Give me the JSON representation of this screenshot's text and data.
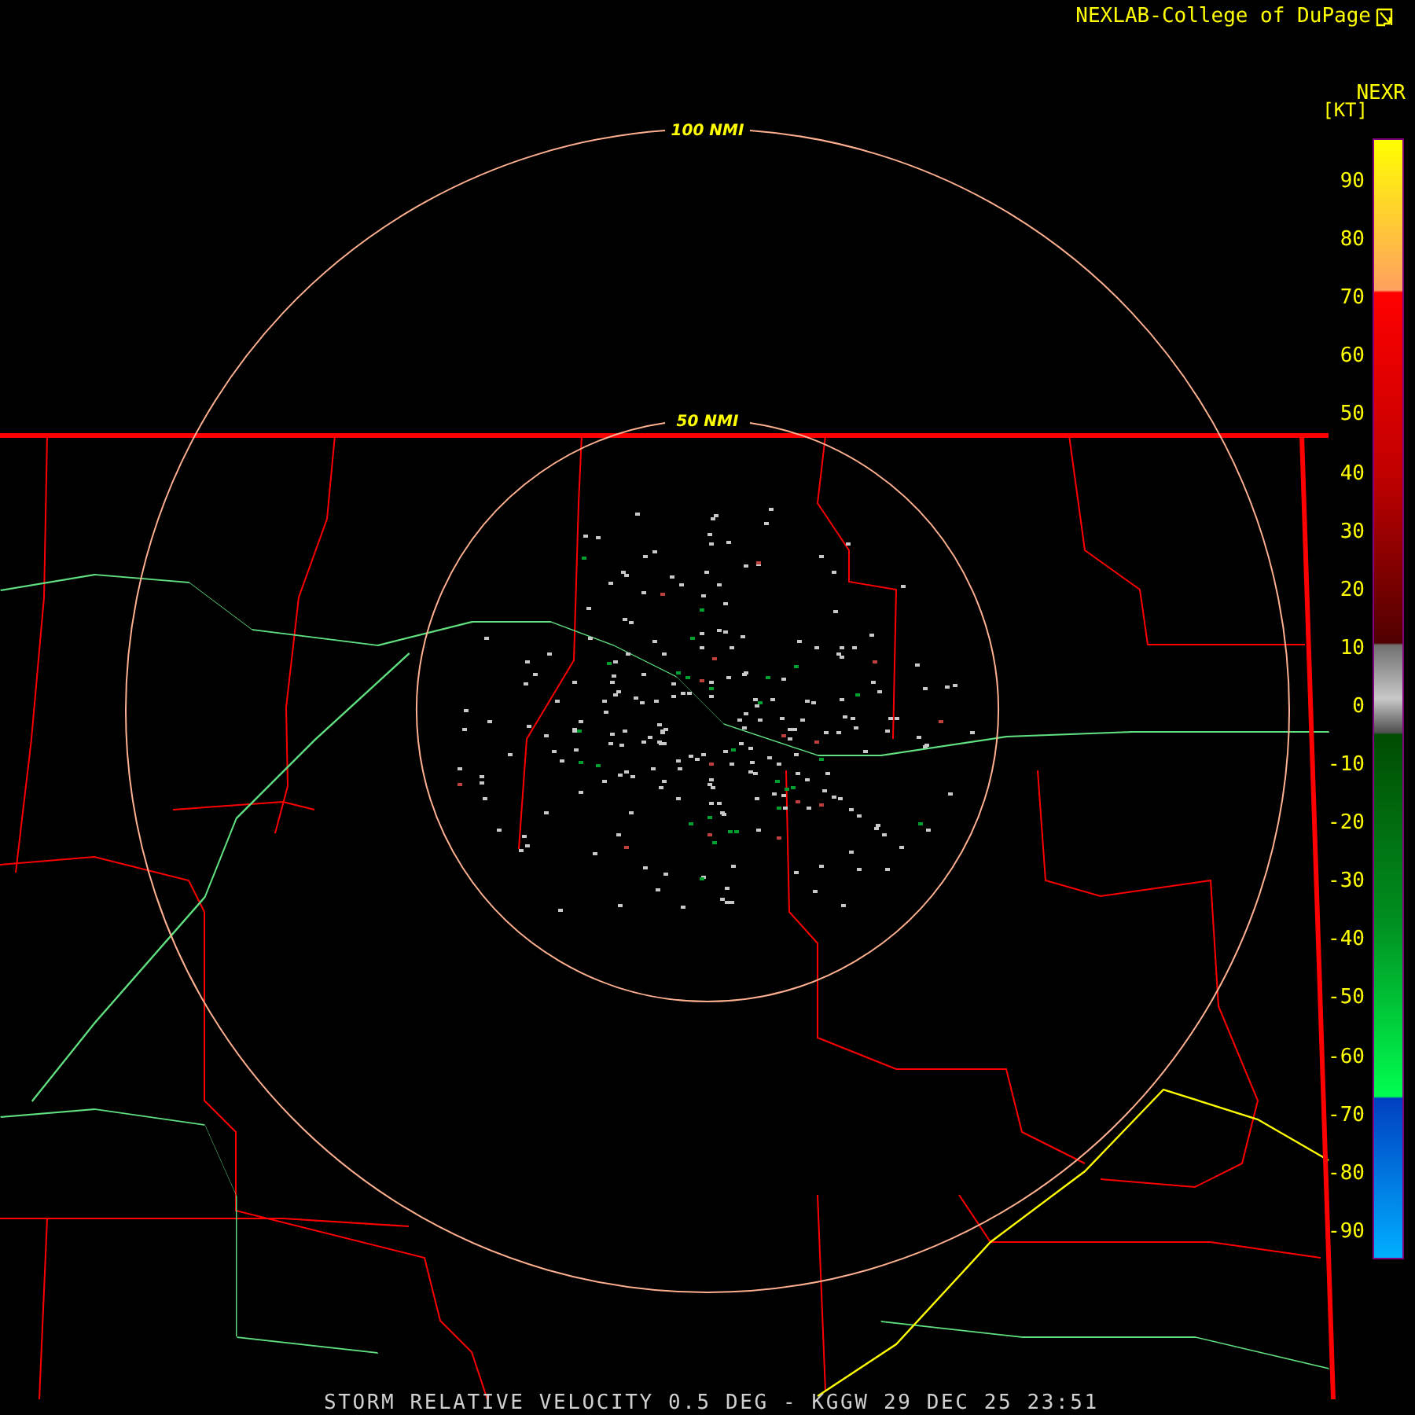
{
  "header": {
    "credit": "NEXLAB-College of DuPage",
    "product": "NEXR",
    "unit": "[KT]"
  },
  "range_rings": [
    {
      "label": "100 NMI"
    },
    {
      "label": "50 NMI"
    }
  ],
  "legend": {
    "ticks": [
      "90",
      "80",
      "70",
      "60",
      "50",
      "40",
      "30",
      "20",
      "10",
      "0",
      "-10",
      "-20",
      "-30",
      "-40",
      "-50",
      "-60",
      "-70",
      "-80",
      "-90"
    ]
  },
  "footer": {
    "caption": "STORM RELATIVE VELOCITY 0.5 DEG - KGGW 29 DEC 25 23:51"
  }
}
